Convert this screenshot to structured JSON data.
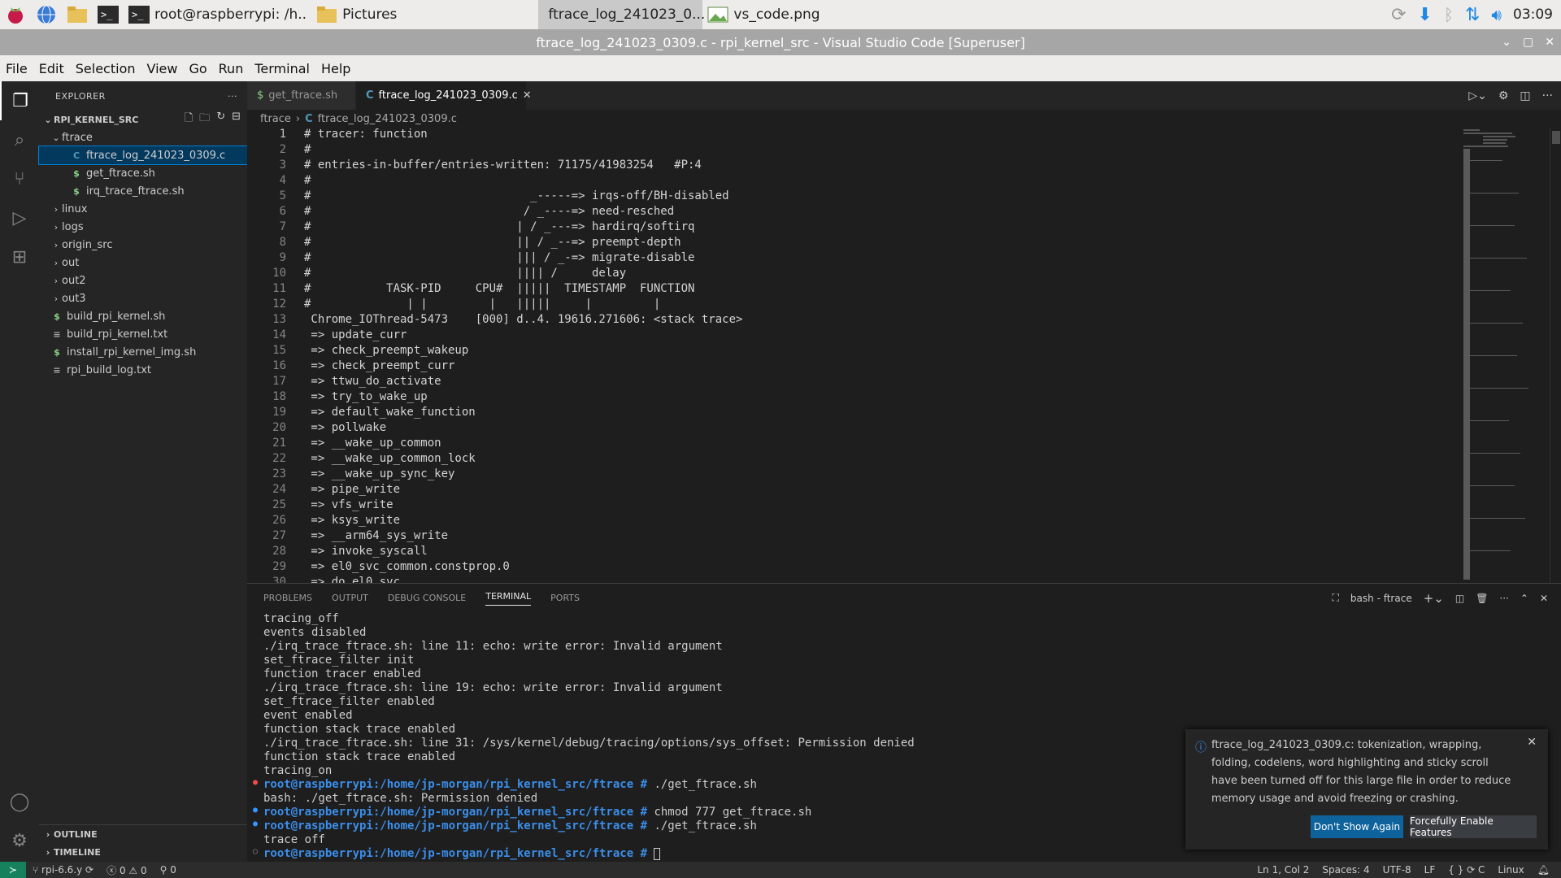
{
  "taskbar": {
    "windows": [
      {
        "label": "root@raspberrypi: /h..",
        "active": false
      },
      {
        "label": "Pictures",
        "active": false
      },
      {
        "label": "ftrace_log_241023_0...",
        "active": true
      },
      {
        "label": "vs_code.png",
        "active": false
      }
    ],
    "clock": "03:09"
  },
  "titlebar": {
    "title": "ftrace_log_241023_0309.c - rpi_kernel_src - Visual Studio Code [Superuser]"
  },
  "menu": [
    "File",
    "Edit",
    "Selection",
    "View",
    "Go",
    "Run",
    "Terminal",
    "Help"
  ],
  "explorer": {
    "header": "EXPLORER",
    "root": "RPI_KERNEL_SRC",
    "items": [
      {
        "label": "ftrace",
        "type": "folder-open",
        "depth": 1
      },
      {
        "label": "ftrace_log_241023_0309.c",
        "type": "c",
        "depth": 2,
        "selected": true
      },
      {
        "label": "get_ftrace.sh",
        "type": "sh",
        "depth": 2
      },
      {
        "label": "irq_trace_ftrace.sh",
        "type": "sh",
        "depth": 2
      },
      {
        "label": "linux",
        "type": "folder",
        "depth": 1
      },
      {
        "label": "logs",
        "type": "folder",
        "depth": 1
      },
      {
        "label": "origin_src",
        "type": "folder",
        "depth": 1
      },
      {
        "label": "out",
        "type": "folder",
        "depth": 1
      },
      {
        "label": "out2",
        "type": "folder",
        "depth": 1
      },
      {
        "label": "out3",
        "type": "folder",
        "depth": 1
      },
      {
        "label": "build_rpi_kernel.sh",
        "type": "sh",
        "depth": 1
      },
      {
        "label": "build_rpi_kernel.txt",
        "type": "txt",
        "depth": 1
      },
      {
        "label": "install_rpi_kernel_img.sh",
        "type": "sh",
        "depth": 1
      },
      {
        "label": "rpi_build_log.txt",
        "type": "txt",
        "depth": 1
      }
    ],
    "outline": "OUTLINE",
    "timeline": "TIMELINE"
  },
  "tabs": [
    {
      "label": "get_ftrace.sh",
      "icon": "$",
      "active": false
    },
    {
      "label": "ftrace_log_241023_0309.c",
      "icon": "C",
      "active": true
    }
  ],
  "breadcrumb": {
    "folder": "ftrace",
    "file": "ftrace_log_241023_0309.c"
  },
  "code_lines": [
    "# tracer: function",
    "#",
    "# entries-in-buffer/entries-written: 71175/41983254   #P:4",
    "#",
    "#                                _-----=> irqs-off/BH-disabled",
    "#                               / _----=> need-resched",
    "#                              | / _---=> hardirq/softirq",
    "#                              || / _--=> preempt-depth",
    "#                              ||| / _-=> migrate-disable",
    "#                              |||| /     delay",
    "#           TASK-PID     CPU#  |||||  TIMESTAMP  FUNCTION",
    "#              | |         |   |||||     |         |",
    " Chrome_IOThread-5473    [000] d..4. 19616.271606: <stack trace>",
    " => update_curr",
    " => check_preempt_wakeup",
    " => check_preempt_curr",
    " => ttwu_do_activate",
    " => try_to_wake_up",
    " => default_wake_function",
    " => pollwake",
    " => __wake_up_common",
    " => __wake_up_common_lock",
    " => __wake_up_sync_key",
    " => pipe_write",
    " => vfs_write",
    " => ksys_write",
    " => __arm64_sys_write",
    " => invoke_syscall",
    " => el0_svc_common.constprop.0",
    " => do_el0_svc"
  ],
  "panel": {
    "tabs": [
      "PROBLEMS",
      "OUTPUT",
      "DEBUG CONSOLE",
      "TERMINAL",
      "PORTS"
    ],
    "active_tab": "TERMINAL",
    "terminal_name": "bash - ftrace"
  },
  "terminal_lines": [
    {
      "text": "tracing_off"
    },
    {
      "text": "events disabled"
    },
    {
      "text": "./irq_trace_ftrace.sh: line 11: echo: write error: Invalid argument"
    },
    {
      "text": "set_ftrace_filter init"
    },
    {
      "text": "function tracer enabled"
    },
    {
      "text": "./irq_trace_ftrace.sh: line 19: echo: write error: Invalid argument"
    },
    {
      "text": "set_ftrace_filter enabled"
    },
    {
      "text": "event enabled"
    },
    {
      "text": "function stack trace enabled"
    },
    {
      "text": "./irq_trace_ftrace.sh: line 31: /sys/kernel/debug/tracing/options/sys_offset: Permission denied"
    },
    {
      "text": "function stack trace enabled"
    },
    {
      "text": "tracing_on"
    },
    {
      "prompt": "root@raspberrypi:/home/jp-morgan/rpi_kernel_src/ftrace #",
      "cmd": " ./get_ftrace.sh",
      "dot": "red"
    },
    {
      "text": "bash: ./get_ftrace.sh: Permission denied"
    },
    {
      "prompt": "root@raspberrypi:/home/jp-morgan/rpi_kernel_src/ftrace #",
      "cmd": " chmod 777 get_ftrace.sh",
      "dot": "blue"
    },
    {
      "prompt": "root@raspberrypi:/home/jp-morgan/rpi_kernel_src/ftrace #",
      "cmd": " ./get_ftrace.sh",
      "dot": "blue"
    },
    {
      "text": "trace off"
    },
    {
      "prompt": "root@raspberrypi:/home/jp-morgan/rpi_kernel_src/ftrace #",
      "cmd": " ",
      "dot": "gray",
      "cursor": true
    }
  ],
  "notification": {
    "message": "ftrace_log_241023_0309.c: tokenization, wrapping, folding, codelens, word highlighting and sticky scroll have been turned off for this large file in order to reduce memory usage and avoid freezing or crashing.",
    "primary": "Don't Show Again",
    "secondary": "Forcefully Enable Features"
  },
  "status": {
    "branch": "rpi-6.6.y",
    "errors": "0",
    "warnings": "0",
    "ports": "0",
    "position": "Ln 1, Col 2",
    "spaces": "Spaces: 4",
    "encoding": "UTF-8",
    "eol": "LF",
    "language": "C",
    "platform": "Linux"
  },
  "colors": {
    "accent": "#007acc",
    "remote": "#16825d",
    "prompt": "#3b8eea"
  }
}
